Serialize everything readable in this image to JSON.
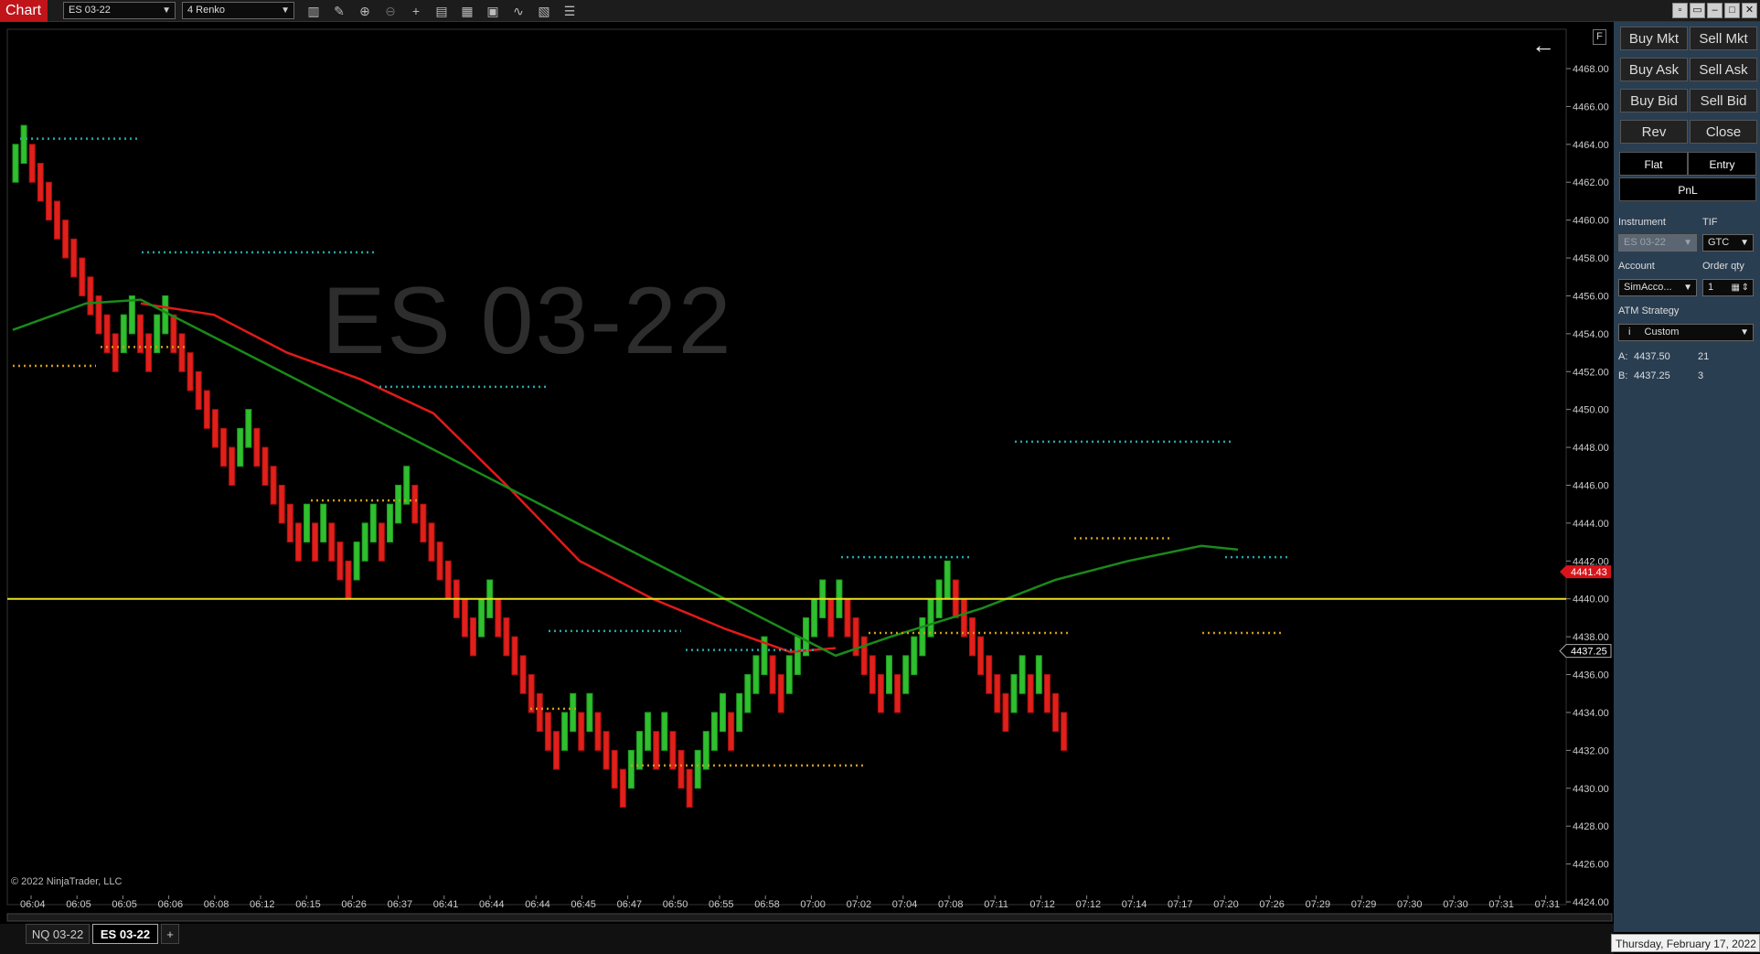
{
  "toolbar": {
    "chart_tab": "Chart",
    "instrument": "ES 03-22",
    "bar_type": "4 Renko",
    "icons": [
      "bars-type-icon",
      "draw-tool-icon",
      "zoom-in-icon",
      "zoom-out-icon",
      "crosshair-icon",
      "data-box-icon",
      "chart-trader-icon",
      "strategies-icon",
      "indicators-icon",
      "properties-icon",
      "object-list-icon"
    ],
    "window_buttons": [
      "restore-icon",
      "workspace-icon",
      "minimize-icon",
      "maximize-icon",
      "close-icon"
    ]
  },
  "chart": {
    "watermark": "ES 03-22",
    "copyright": "© 2022 NinjaTrader, LLC",
    "f_button": "F",
    "price_labels": [
      "4468.00",
      "4466.00",
      "4464.00",
      "4462.00",
      "4460.00",
      "4458.00",
      "4456.00",
      "4454.00",
      "4452.00",
      "4450.00",
      "4448.00",
      "4446.00",
      "4444.00",
      "4442.00",
      "4440.00",
      "4438.00",
      "4436.00",
      "4434.00",
      "4432.00",
      "4430.00",
      "4428.00",
      "4426.00",
      "4424.00"
    ],
    "time_labels": [
      "06:04",
      "06:05",
      "06:05",
      "06:06",
      "06:08",
      "06:12",
      "06:15",
      "06:26",
      "06:37",
      "06:41",
      "06:44",
      "06:44",
      "06:45",
      "06:47",
      "06:50",
      "06:55",
      "06:58",
      "07:00",
      "07:02",
      "07:04",
      "07:08",
      "07:11",
      "07:12",
      "07:12",
      "07:14",
      "07:17",
      "07:20",
      "07:26",
      "07:29",
      "07:29",
      "07:30",
      "07:30",
      "07:31",
      "07:31"
    ],
    "current_price_flag": "4441.43",
    "last_price_flag": "4437.25",
    "horizontal_line_price": 4440.0
  },
  "chart_data": {
    "type": "renko",
    "brick_size": 1.0,
    "price_range": [
      4423,
      4469
    ],
    "bricks_sequence": [
      "G",
      "G",
      "R",
      "R",
      "R",
      "R",
      "R",
      "R",
      "R",
      "R",
      "R",
      "R",
      "R",
      "G",
      "G",
      "R",
      "R",
      "G",
      "G",
      "R",
      "R",
      "R",
      "R",
      "R",
      "R",
      "R",
      "R",
      "G",
      "G",
      "R",
      "R",
      "R",
      "R",
      "R",
      "R",
      "G",
      "R",
      "G",
      "R",
      "R",
      "R",
      "G",
      "G",
      "G",
      "R",
      "G",
      "G",
      "G",
      "R",
      "R",
      "R",
      "R",
      "R",
      "R",
      "R",
      "R",
      "G",
      "G",
      "R",
      "R",
      "R",
      "R",
      "R",
      "R",
      "R",
      "R",
      "G",
      "G",
      "R",
      "G",
      "R",
      "R",
      "R",
      "R",
      "G",
      "G",
      "G",
      "R",
      "G",
      "R",
      "R",
      "R",
      "G",
      "G",
      "G",
      "G",
      "R",
      "G",
      "G",
      "G",
      "G",
      "R",
      "R",
      "G",
      "G",
      "G",
      "G",
      "G",
      "R",
      "G",
      "R",
      "R",
      "R",
      "R",
      "R",
      "G",
      "R",
      "G",
      "G",
      "G",
      "G",
      "G",
      "G",
      "R",
      "R",
      "R",
      "R",
      "R",
      "R",
      "R",
      "G",
      "G",
      "R",
      "G",
      "R",
      "R",
      "R"
    ],
    "red_ma": [
      [
        0,
        null
      ],
      [
        140,
        4455.6
      ],
      [
        220,
        4455.0
      ],
      [
        300,
        4453.0
      ],
      [
        380,
        4451.6
      ],
      [
        460,
        4449.8
      ],
      [
        540,
        4446.0
      ],
      [
        620,
        4442.0
      ],
      [
        700,
        4440.0
      ],
      [
        780,
        4438.4
      ],
      [
        850,
        4437.2
      ],
      [
        900,
        4437.4
      ]
    ],
    "green_ma": [
      [
        0,
        4454.2
      ],
      [
        80,
        4455.6
      ],
      [
        140,
        4455.8
      ],
      [
        900,
        4437.0
      ],
      [
        960,
        4438.0
      ],
      [
        1060,
        4439.5
      ],
      [
        1140,
        4441.0
      ],
      [
        1220,
        4442.0
      ],
      [
        1300,
        4442.8
      ],
      [
        1340,
        4442.6
      ]
    ]
  },
  "bottom": {
    "tabs": [
      "NQ 03-22",
      "ES 03-22"
    ],
    "add_tab": "+",
    "status_date": "Thursday, February 17, 2022"
  },
  "trader": {
    "buttons": {
      "buy_mkt": "Buy Mkt",
      "sell_mkt": "Sell Mkt",
      "buy_ask": "Buy Ask",
      "sell_ask": "Sell Ask",
      "buy_bid": "Buy Bid",
      "sell_bid": "Sell Bid",
      "rev": "Rev",
      "close": "Close"
    },
    "flat": "Flat",
    "entry": "Entry",
    "pnl": "PnL",
    "instrument_label": "Instrument",
    "tif_label": "TIF",
    "instrument_value": "ES 03-22",
    "tif_value": "GTC",
    "account_label": "Account",
    "order_qty_label": "Order qty",
    "account_value": "SimAcco...",
    "order_qty_value": "1",
    "atm_label": "ATM Strategy",
    "atm_value": "Custom",
    "ask_label": "A:",
    "ask_price": "4437.50",
    "ask_size": "21",
    "bid_label": "B:",
    "bid_price": "4437.25",
    "bid_size": "3"
  }
}
